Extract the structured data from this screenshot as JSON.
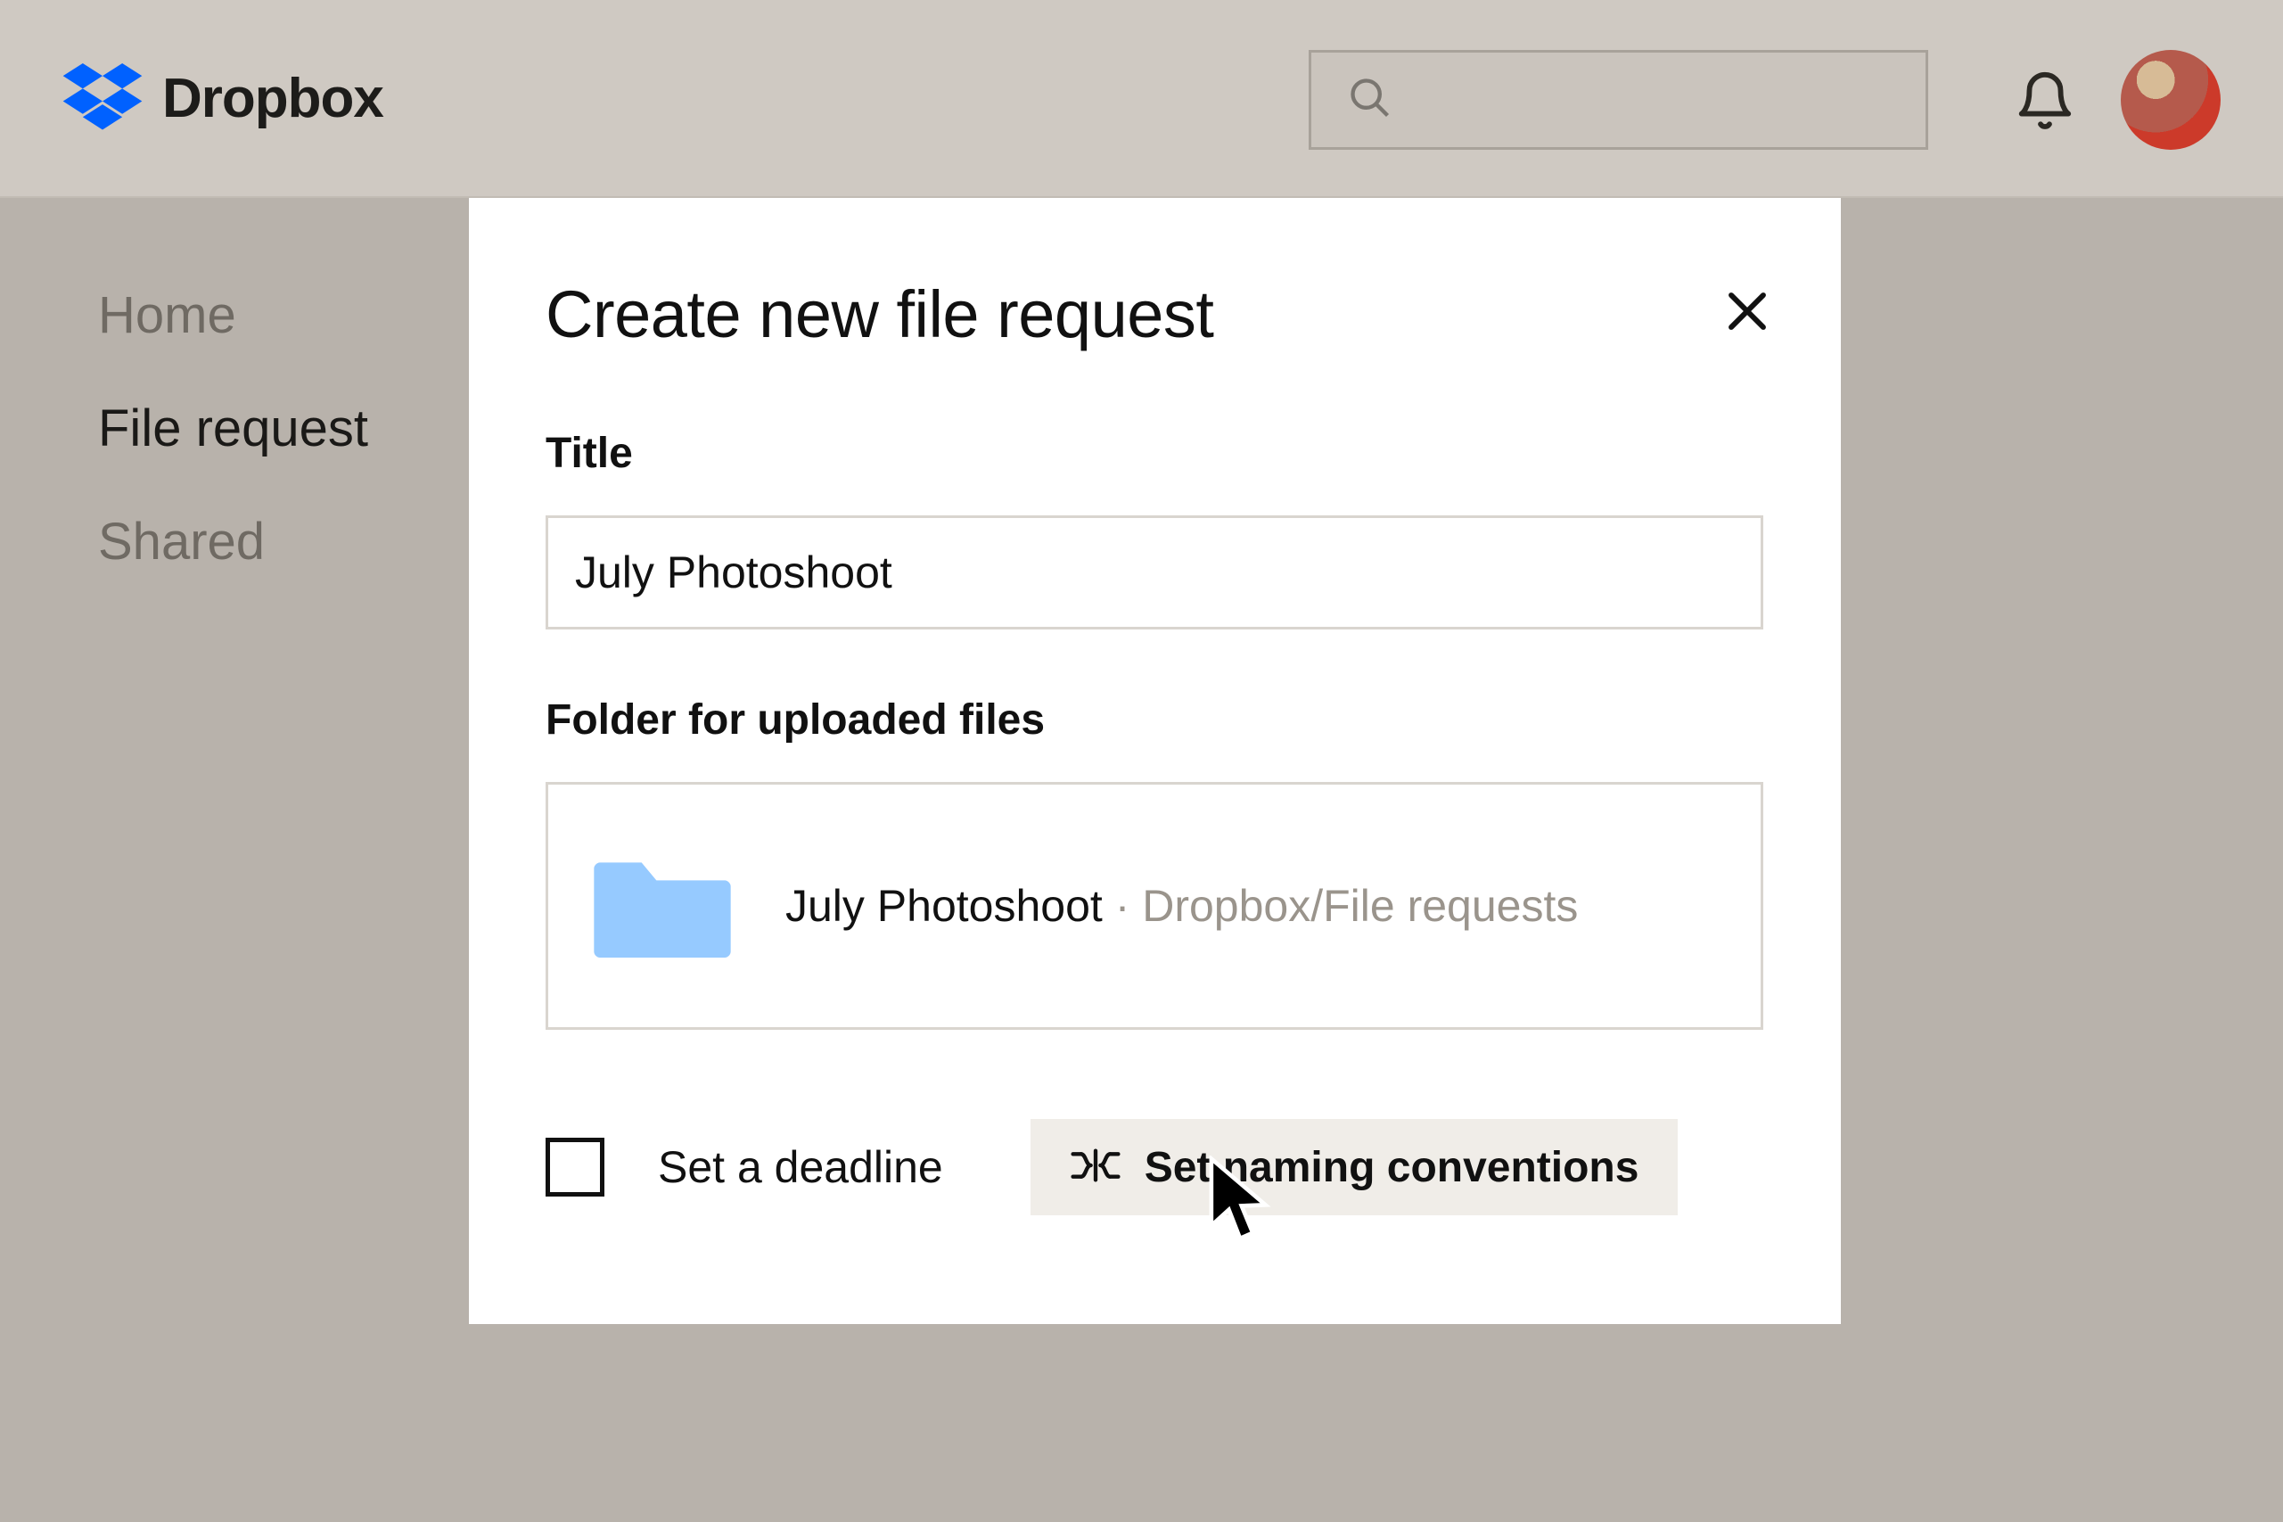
{
  "header": {
    "brand_name": "Dropbox",
    "search_placeholder": ""
  },
  "sidebar": {
    "items": [
      {
        "label": "Home",
        "active": false
      },
      {
        "label": "File request",
        "active": true
      },
      {
        "label": "Shared",
        "active": false
      }
    ]
  },
  "dialog": {
    "heading": "Create new file request",
    "title_label": "Title",
    "title_value": "July Photoshoot",
    "folder_label": "Folder for uploaded files",
    "folder_name": "July Photoshoot",
    "folder_separator": " · ",
    "folder_path": "Dropbox/File requests",
    "deadline_label": "Set a deadline",
    "deadline_checked": false,
    "naming_button": "Set naming conventions"
  }
}
